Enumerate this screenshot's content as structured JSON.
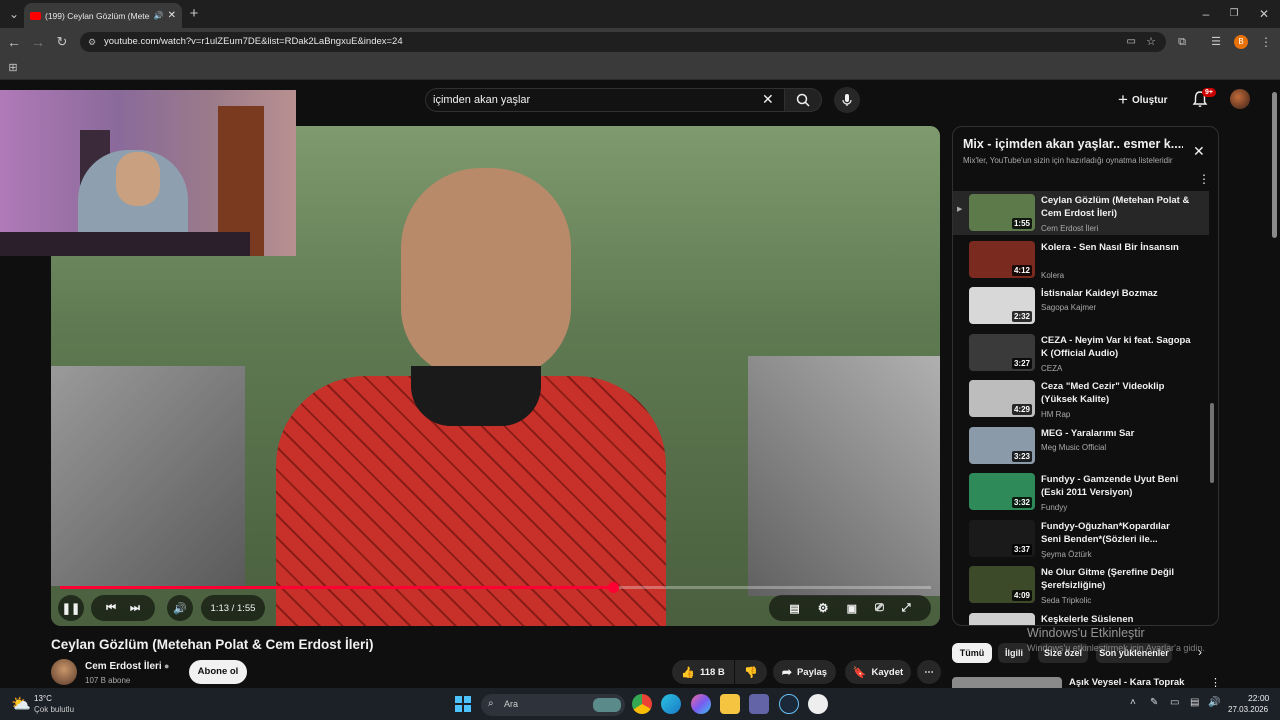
{
  "browser": {
    "tab_title": "(199) Ceylan Gözlüm (Meteh...",
    "url": "youtube.com/watch?v=r1ulZEum7DE&list=RDak2LaBngxuE&index=24"
  },
  "youtube": {
    "search_value": "içimden akan yaşlar",
    "create_label": "Oluştur",
    "notif_badge": "9+",
    "player": {
      "time": "1:13 / 1:55",
      "progress_fraction": 0.635
    },
    "video": {
      "title": "Ceylan Gözlüm (Metehan Polat & Cem Erdost İleri)",
      "channel": "Cem Erdost İleri",
      "subscribers": "107 B abone",
      "subscribe_label": "Abone ol",
      "likes": "118 B",
      "share_label": "Paylaş",
      "save_label": "Kaydet"
    },
    "playlist": {
      "title": "Mix - içimden akan yaşlar.. esmer k....",
      "subtitle": "Mix'ler, YouTube'un sizin için hazırladığı oynatma listeleridir",
      "items": [
        {
          "title": "Ceylan Gözlüm (Metehan Polat & Cem Erdost İleri)",
          "channel": "Cem Erdost İleri",
          "duration": "1:55",
          "thumb": "#5c7a4a",
          "current": true
        },
        {
          "title": "Kolera - Sen Nasıl Bir İnsansın",
          "channel": "Kolera",
          "duration": "4:12",
          "thumb": "#7a2a1e"
        },
        {
          "title": "İstisnalar Kaideyi Bozmaz",
          "channel": "Sagopa Kajmer",
          "duration": "2:32",
          "thumb": "#d8d8d8"
        },
        {
          "title": "CEZA - Neyim Var ki feat. Sagopa K (Official Audio)",
          "channel": "CEZA",
          "duration": "3:27",
          "thumb": "#3a3a3a"
        },
        {
          "title": "Ceza \"Med Cezir\" Videoklip (Yüksek Kalite)",
          "channel": "HM Rap",
          "duration": "4:29",
          "thumb": "#bdbdbd"
        },
        {
          "title": "MEG - Yaralarımı Sar",
          "channel": "Meg Music Official",
          "duration": "3:23",
          "thumb": "#8a9aa8"
        },
        {
          "title": "Fundyy - Gamzende Uyut Beni (Eski 2011 Versiyon)",
          "channel": "Fundyy",
          "duration": "3:32",
          "thumb": "#2f8a5a"
        },
        {
          "title": "Fundyy-Oğuzhan*Kopardılar Seni Benden*(Sözleri ile...",
          "channel": "Şeyma Öztürk",
          "duration": "3:37",
          "thumb": "#1a1a1a"
        },
        {
          "title": "Ne Olur Gitme (Şerefine Değil Şerefsizliğine)",
          "channel": "Seda Tripkolic",
          "duration": "4:09",
          "thumb": "#3c4a2a"
        },
        {
          "title": "Keşkelerle Süslenen Sonbaharlar / Elvedayla...",
          "channel": "",
          "duration": "",
          "thumb": "#cfcfcf"
        }
      ]
    },
    "chips": [
      "Tümü",
      "İlgili",
      "Size özel",
      "Son yüklenenler"
    ],
    "next_video_title": "Aşık Veysel - Kara Toprak",
    "watermark_title": "Windows'u Etkinleştir",
    "watermark_sub": "Windows'u etkinleştirmek için Ayarlar'a gidin."
  },
  "taskbar": {
    "weather_temp": "13°C",
    "weather_desc": "Çok bulutlu",
    "search_placeholder": "Ara",
    "time": "22:00",
    "date": "27.03.2026"
  }
}
